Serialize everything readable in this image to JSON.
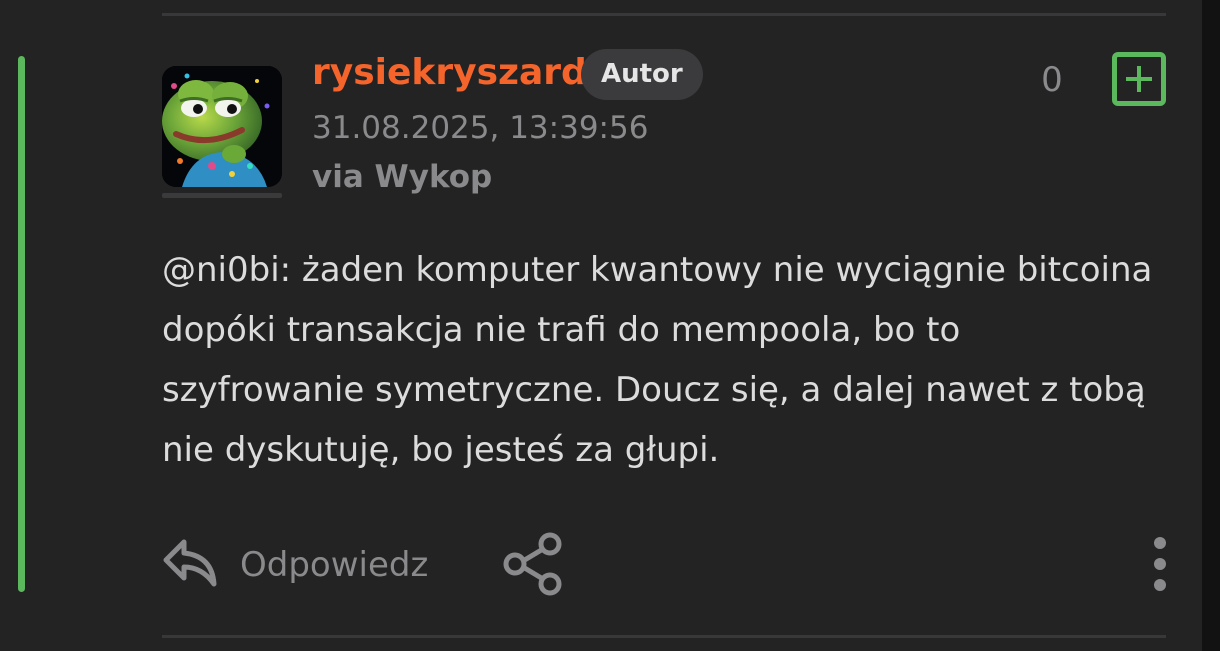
{
  "comment": {
    "username": "rysiekryszard",
    "badge": "Autor",
    "timestamp": "31.08.2025, 13:39:56",
    "via": "via Wykop",
    "vote_count": "0",
    "mention": "@ni0bi",
    "text": ": żaden komputer kwantowy nie wyciągnie bitcoina dopóki transakcja nie trafi do mempoola, bo to szyfrowanie symetryczne. Doucz się, a dalej nawet z tobą nie dyskutuję, bo jesteś za głupi.",
    "avatar_icon": "pepe-frog-avatar"
  },
  "actions": {
    "reply_label": "Odpowiedz",
    "reply_icon": "reply-arrow-icon",
    "share_icon": "share-icon",
    "more_icon": "more-vertical-icon",
    "plus_icon": "plus-square-icon"
  },
  "colors": {
    "username": "#f5652b",
    "thread_line": "#5cb85c",
    "plus_button": "#5cb85c",
    "background": "#232324",
    "muted_text": "#8a8a8d",
    "body_text": "#dcdcdc"
  }
}
